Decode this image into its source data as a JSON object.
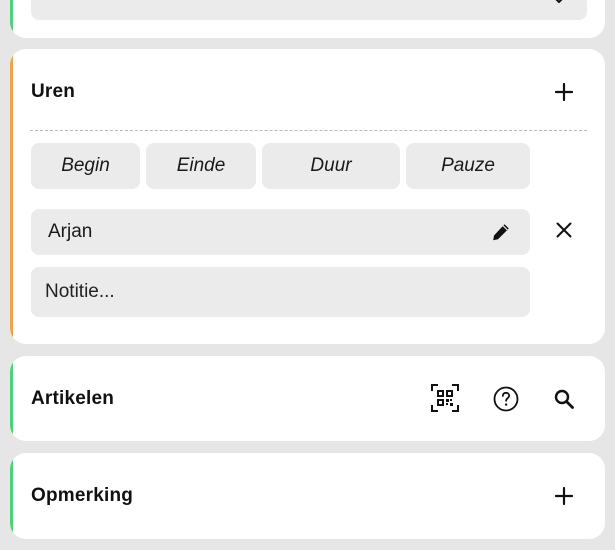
{
  "uren": {
    "title": "Uren",
    "chips": [
      "Begin",
      "Einde",
      "Duur",
      "Pauze"
    ],
    "employee": "Arjan",
    "note_placeholder": "Notitie..."
  },
  "artikelen": {
    "title": "Artikelen"
  },
  "opmerking": {
    "title": "Opmerking"
  },
  "colors": {
    "accent_green": "#4cd07a",
    "accent_orange": "#f0a24a",
    "field_bg": "#ebebeb",
    "page_bg": "#e6e6e6"
  }
}
